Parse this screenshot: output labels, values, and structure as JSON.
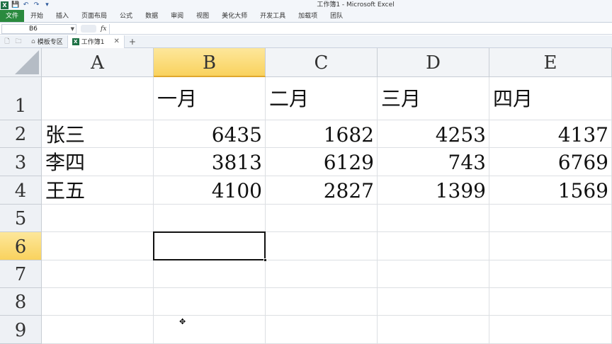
{
  "window": {
    "title": "工作簿1 - Microsoft Excel"
  },
  "qat": {
    "logo": "X",
    "save_icon": "💾",
    "undo_icon": "↶",
    "redo_icon": "↷",
    "customize_icon": "▾"
  },
  "ribbon": {
    "file_tab": "文件",
    "tabs": [
      "开始",
      "插入",
      "页面布局",
      "公式",
      "数据",
      "审阅",
      "视图",
      "美化大师",
      "开发工具",
      "加载项",
      "团队"
    ]
  },
  "formula_bar": {
    "name_box": "B6",
    "fx": "fx",
    "value": ""
  },
  "doc_tabs": [
    {
      "label": "模板专区",
      "active": false
    },
    {
      "label": "工作簿1",
      "active": true
    }
  ],
  "sheet": {
    "columns": [
      "A",
      "B",
      "C",
      "D",
      "E"
    ],
    "rows": [
      "1",
      "2",
      "3",
      "4",
      "5",
      "6",
      "7",
      "8",
      "9"
    ],
    "selected_column": "B",
    "selected_row": "6",
    "cells": [
      [
        "",
        "一月",
        "二月",
        "三月",
        "四月"
      ],
      [
        "张三",
        "6435",
        "1682",
        "4253",
        "4137"
      ],
      [
        "李四",
        "3813",
        "6129",
        "743",
        "6769"
      ],
      [
        "王五",
        "4100",
        "2827",
        "1399",
        "1569"
      ],
      [
        "",
        "",
        "",
        "",
        ""
      ],
      [
        "",
        "",
        "",
        "",
        ""
      ],
      [
        "",
        "",
        "",
        "",
        ""
      ],
      [
        "",
        "",
        "",
        "",
        ""
      ],
      [
        "",
        "",
        "",
        "",
        ""
      ]
    ]
  },
  "colors": {
    "file_tab": "#2a8a3e",
    "header_selected": "#f9d25e",
    "excel_green": "#1e7145"
  }
}
